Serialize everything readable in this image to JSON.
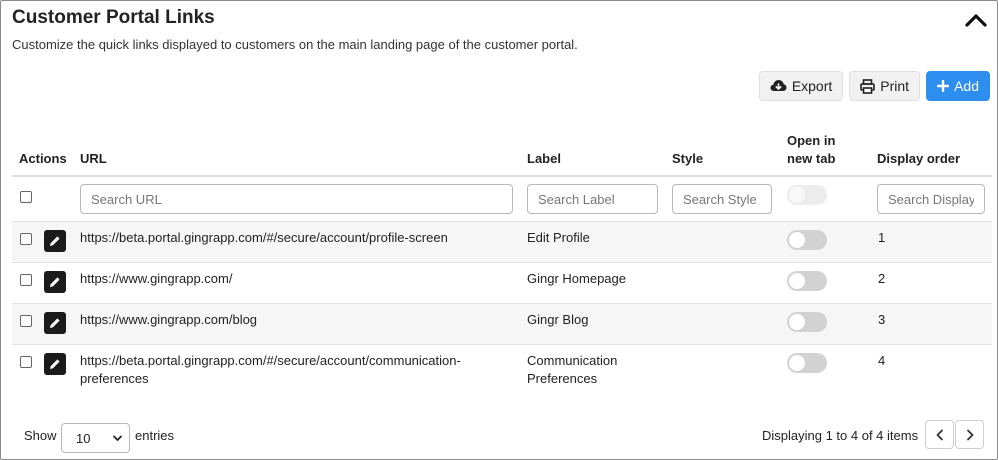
{
  "header": {
    "title": "Customer Portal Links",
    "subtitle": "Customize the quick links displayed to customers on the main landing page of the customer portal."
  },
  "toolbar": {
    "export_label": "Export",
    "print_label": "Print",
    "add_label": "Add"
  },
  "table": {
    "columns": {
      "actions": "Actions",
      "url": "URL",
      "label": "Label",
      "style": "Style",
      "open_new_tab_line1": "Open in",
      "open_new_tab_line2": "new tab",
      "display_order": "Display order"
    },
    "search": {
      "url_placeholder": "Search URL",
      "label_placeholder": "Search Label",
      "style_placeholder": "Search Style",
      "order_placeholder": "Search Display"
    },
    "rows": [
      {
        "url_line1": "https://beta.portal.gingrapp.com/#/secure/account/profile-screen",
        "url_line2": "",
        "label_line1": "Edit Profile",
        "label_line2": "",
        "style": "",
        "open_in_new_tab": false,
        "order": "1"
      },
      {
        "url_line1": "https://www.gingrapp.com/",
        "url_line2": "",
        "label_line1": "Gingr Homepage",
        "label_line2": "",
        "style": "",
        "open_in_new_tab": false,
        "order": "2"
      },
      {
        "url_line1": "https://www.gingrapp.com/blog",
        "url_line2": "",
        "label_line1": "Gingr Blog",
        "label_line2": "",
        "style": "",
        "open_in_new_tab": false,
        "order": "3"
      },
      {
        "url_line1": "https://beta.portal.gingrapp.com/#/secure/account/communication-",
        "url_line2": "preferences",
        "label_line1": "Communication",
        "label_line2": "Preferences",
        "style": "",
        "open_in_new_tab": false,
        "order": "4"
      }
    ]
  },
  "footer": {
    "show_label": "Show",
    "page_size": "10",
    "entries_label": "entries",
    "info": "Displaying 1 to 4 of 4 items"
  },
  "icons": {
    "collapse": "chevron-up-icon",
    "export": "cloud-download-icon",
    "print": "printer-icon",
    "add": "plus-icon",
    "edit": "pencil-icon",
    "prev": "chevron-left-icon",
    "next": "chevron-right-icon"
  },
  "colors": {
    "primary": "#2d8ef0",
    "edit_button": "#1b1b1b"
  }
}
